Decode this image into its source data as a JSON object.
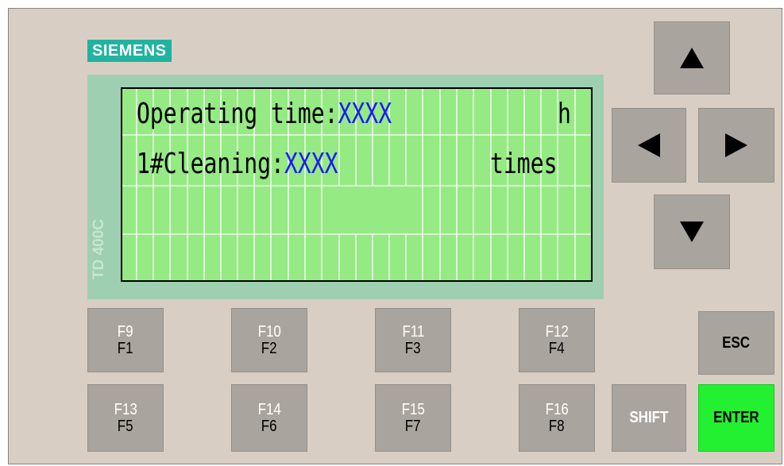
{
  "brand": {
    "logo_text": "SIEMENS",
    "model": "TD 400C"
  },
  "display": {
    "line1": {
      "label": "Operating time:",
      "value": "XXXX",
      "unit": "h"
    },
    "line2": {
      "label": "1#Cleaning:",
      "value": "XXXX",
      "unit": "times"
    }
  },
  "function_keys": [
    {
      "shift_label": "F9",
      "label": "F1"
    },
    {
      "shift_label": "F10",
      "label": "F2"
    },
    {
      "shift_label": "F11",
      "label": "F3"
    },
    {
      "shift_label": "F12",
      "label": "F4"
    },
    {
      "shift_label": "F13",
      "label": "F5"
    },
    {
      "shift_label": "F14",
      "label": "F6"
    },
    {
      "shift_label": "F15",
      "label": "F7"
    },
    {
      "shift_label": "F16",
      "label": "F8"
    }
  ],
  "control_keys": {
    "esc": "ESC",
    "shift": "SHIFT",
    "enter": "ENTER"
  },
  "nav_keys": {
    "up": "arrow-up-icon",
    "down": "arrow-down-icon",
    "left": "arrow-left-icon",
    "right": "arrow-right-icon"
  },
  "colors": {
    "panel": "#d8cec4",
    "lcd": "#95ea83",
    "key": "#aaa49e",
    "enter_key": "#22f030",
    "value_text": "#1a1aff",
    "logo": "#1fb3a0"
  }
}
